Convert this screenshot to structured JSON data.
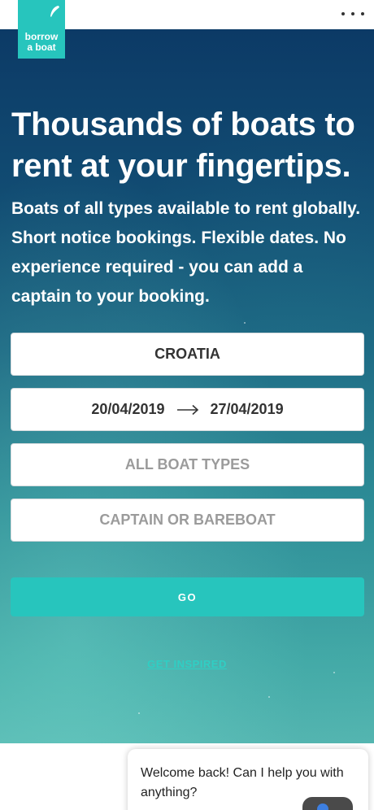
{
  "brand": {
    "logo_line1": "borrow",
    "logo_line2": "a boat",
    "color": "#27c5bd"
  },
  "header": {
    "menu_icon": "more-horizontal-icon"
  },
  "hero": {
    "title": "Thousands of boats to rent at your fingertips.",
    "subtitle": "Boats of all types available to rent globally. Short notice bookings. Flexible dates. No experience required - you can add a captain to your booking."
  },
  "search": {
    "destination": "CROATIA",
    "date_from": "20/04/2019",
    "date_to": "27/04/2019",
    "date_arrow_icon": "arrow-right-icon",
    "boat_types_placeholder": "ALL BOAT TYPES",
    "captain_placeholder": "CAPTAIN OR BAREBOAT",
    "go_label": "GO"
  },
  "links": {
    "get_inspired": "GET INSPIRED"
  },
  "chat": {
    "message": "Welcome back! Can I help you with anything?"
  }
}
